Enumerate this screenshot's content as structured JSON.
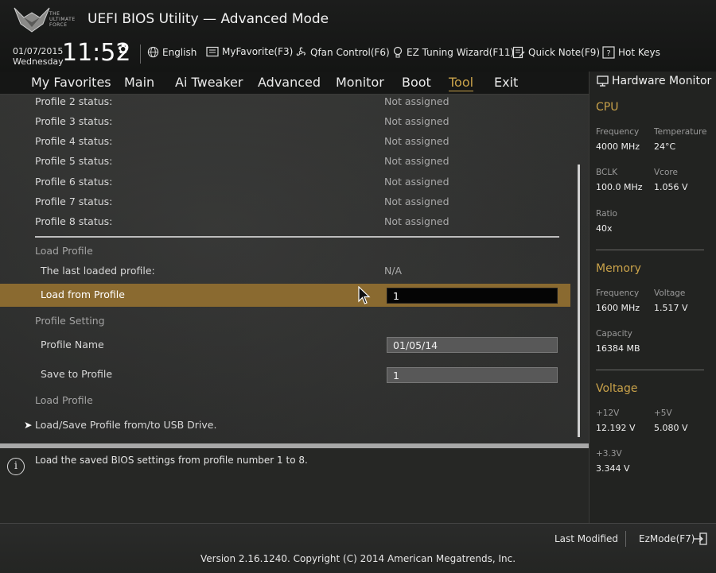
{
  "header": {
    "logo_text": "THE ULTIMATE FORCE",
    "title": "UEFI BIOS Utility — Advanced Mode",
    "date": "01/07/2015",
    "weekday": "Wednesday",
    "time": "11:52",
    "tools": [
      {
        "label": "English",
        "icon": "globe-icon"
      },
      {
        "label": "MyFavorite(F3)",
        "icon": "favorite-icon"
      },
      {
        "label": "Qfan Control(F6)",
        "icon": "fan-icon"
      },
      {
        "label": "EZ Tuning Wizard(F11)",
        "icon": "bulb-icon"
      },
      {
        "label": "Quick Note(F9)",
        "icon": "note-icon"
      },
      {
        "label": "Hot Keys",
        "icon": "help-key-icon"
      }
    ]
  },
  "menu": [
    "My Favorites",
    "Main",
    "Ai Tweaker",
    "Advanced",
    "Monitor",
    "Boot",
    "Tool",
    "Exit"
  ],
  "active_menu": "Tool",
  "profiles": [
    {
      "label": "Profile 2 status:",
      "value": "Not assigned"
    },
    {
      "label": "Profile 3 status:",
      "value": "Not assigned"
    },
    {
      "label": "Profile 4 status:",
      "value": "Not assigned"
    },
    {
      "label": "Profile 5 status:",
      "value": "Not assigned"
    },
    {
      "label": "Profile 6 status:",
      "value": "Not assigned"
    },
    {
      "label": "Profile 7 status:",
      "value": "Not assigned"
    },
    {
      "label": "Profile 8 status:",
      "value": "Not assigned"
    }
  ],
  "load_section": {
    "heading": "Load Profile",
    "last_loaded_label": "The last loaded profile:",
    "last_loaded_value": "N/A",
    "load_from_label": "Load from Profile",
    "load_from_value": "1"
  },
  "setting_section": {
    "heading": "Profile Setting",
    "name_label": "Profile Name",
    "name_value": "01/05/14",
    "save_label": "Save to Profile",
    "save_value": "1",
    "load_label": "Load Profile"
  },
  "usb_item": "Load/Save Profile from/to USB Drive.",
  "help_text": "Load the saved BIOS settings from profile number 1 to 8.",
  "hardware_monitor": {
    "title": "Hardware Monitor",
    "cpu": {
      "heading": "CPU",
      "frequency_label": "Frequency",
      "frequency": "4000 MHz",
      "temperature_label": "Temperature",
      "temperature": "24°C",
      "bclk_label": "BCLK",
      "bclk": "100.0 MHz",
      "vcore_label": "Vcore",
      "vcore": "1.056 V",
      "ratio_label": "Ratio",
      "ratio": "40x"
    },
    "memory": {
      "heading": "Memory",
      "frequency_label": "Frequency",
      "frequency": "1600 MHz",
      "voltage_label": "Voltage",
      "voltage": "1.517 V",
      "capacity_label": "Capacity",
      "capacity": "16384 MB"
    },
    "voltage": {
      "heading": "Voltage",
      "v12_label": "+12V",
      "v12": "12.192 V",
      "v5_label": "+5V",
      "v5": "5.080 V",
      "v33_label": "+3.3V",
      "v33": "3.344 V"
    }
  },
  "footer": {
    "last_modified": "Last Modified",
    "ezmode": "EzMode(F7)",
    "copyright": "Version 2.16.1240. Copyright (C) 2014 American Megatrends, Inc."
  },
  "colors": {
    "accent": "#c9a24a",
    "highlight": "#8a6a30"
  }
}
